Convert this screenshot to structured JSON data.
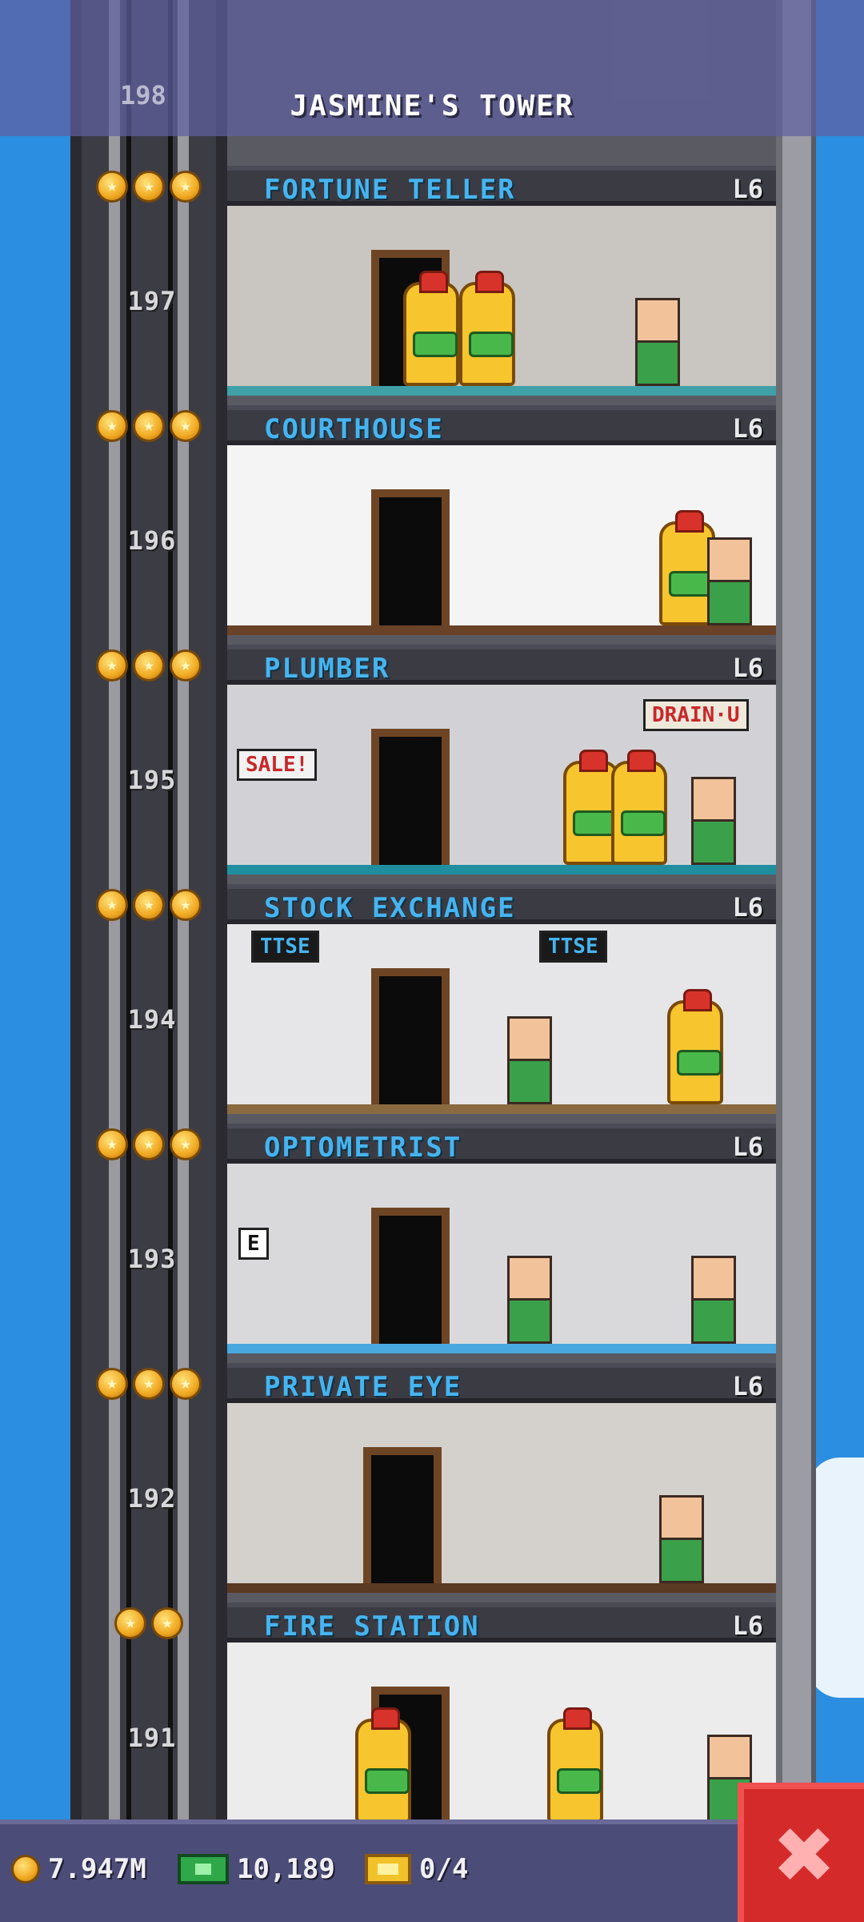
{
  "header": {
    "title": "JASMINE'S TOWER",
    "top_floor_number": "198"
  },
  "floors": [
    {
      "number": "197",
      "name": "FORTUNE TELLER",
      "level": "L6",
      "stars": 3,
      "wall": "#c9c6c1",
      "floor": "#3fa0a8"
    },
    {
      "number": "196",
      "name": "COURTHOUSE",
      "level": "L6",
      "stars": 3,
      "wall": "#f4f4f4",
      "floor": "#6a4228"
    },
    {
      "number": "195",
      "name": "PLUMBER",
      "level": "L6",
      "stars": 3,
      "wall": "#d2d2d6",
      "floor": "#1f8fa0"
    },
    {
      "number": "194",
      "name": "STOCK EXCHANGE",
      "level": "L6",
      "stars": 3,
      "wall": "#e6e6e8",
      "floor": "#8a6a40"
    },
    {
      "number": "193",
      "name": "OPTOMETRIST",
      "level": "L6",
      "stars": 3,
      "wall": "#d9d9dc",
      "floor": "#4aa8e0"
    },
    {
      "number": "192",
      "name": "PRIVATE EYE",
      "level": "L6",
      "stars": 3,
      "wall": "#d4d1cd",
      "floor": "#5a3a22"
    },
    {
      "number": "191",
      "name": "FIRE STATION",
      "level": "L6",
      "stars": 2,
      "wall": "#ececec",
      "floor": "#555555"
    }
  ],
  "room_details": {
    "plumber_sign": "DRAIN·U",
    "plumber_sale": "SALE!",
    "stock_sign_left": "TTSE",
    "stock_sign_right": "TTSE",
    "eye_chart": "E"
  },
  "status_bar": {
    "coins": "7.947M",
    "bux": "10,189",
    "tickets": "0/4"
  },
  "colors": {
    "sky": "#2b8ee0",
    "floor_label": "#46b4f0",
    "close_button": "#d42a2a"
  },
  "icons": {
    "coin": "coin-icon",
    "bux": "bux-icon",
    "ticket": "ticket-icon",
    "close": "close-icon"
  },
  "close_glyph": "✖"
}
